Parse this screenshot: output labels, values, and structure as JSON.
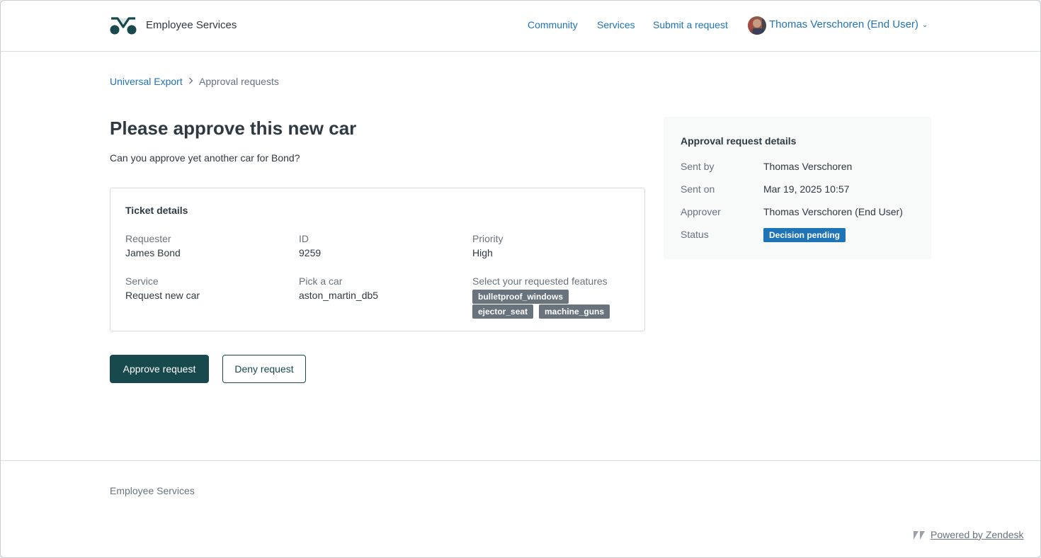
{
  "header": {
    "brand": "Employee Services",
    "nav": [
      "Community",
      "Services",
      "Submit a request"
    ],
    "user": "Thomas Verschoren (End User)"
  },
  "breadcrumb": {
    "parent": "Universal Export",
    "current": "Approval requests"
  },
  "request": {
    "title": "Please approve this new car",
    "description": "Can you approve yet another car for Bond?"
  },
  "ticket": {
    "heading": "Ticket details",
    "requester_label": "Requester",
    "requester": "James Bond",
    "id_label": "ID",
    "id": "9259",
    "priority_label": "Priority",
    "priority": "High",
    "service_label": "Service",
    "service": "Request new car",
    "car_label": "Pick a car",
    "car": "aston_martin_db5",
    "features_label": "Select your requested features",
    "features": [
      "bulletproof_windows",
      "ejector_seat",
      "machine_guns"
    ]
  },
  "actions": {
    "approve": "Approve request",
    "deny": "Deny request"
  },
  "details": {
    "heading": "Approval request details",
    "sent_by_label": "Sent by",
    "sent_by": "Thomas Verschoren",
    "sent_on_label": "Sent on",
    "sent_on": "Mar 19, 2025 10:57",
    "approver_label": "Approver",
    "approver": "Thomas Verschoren (End User)",
    "status_label": "Status",
    "status": "Decision pending"
  },
  "footer": {
    "brand": "Employee Services",
    "powered_by": "Powered by Zendesk"
  },
  "colors": {
    "primary": "#17494d",
    "link": "#1f73b7",
    "status_badge": "#1f73b7",
    "tag": "#68737d"
  }
}
